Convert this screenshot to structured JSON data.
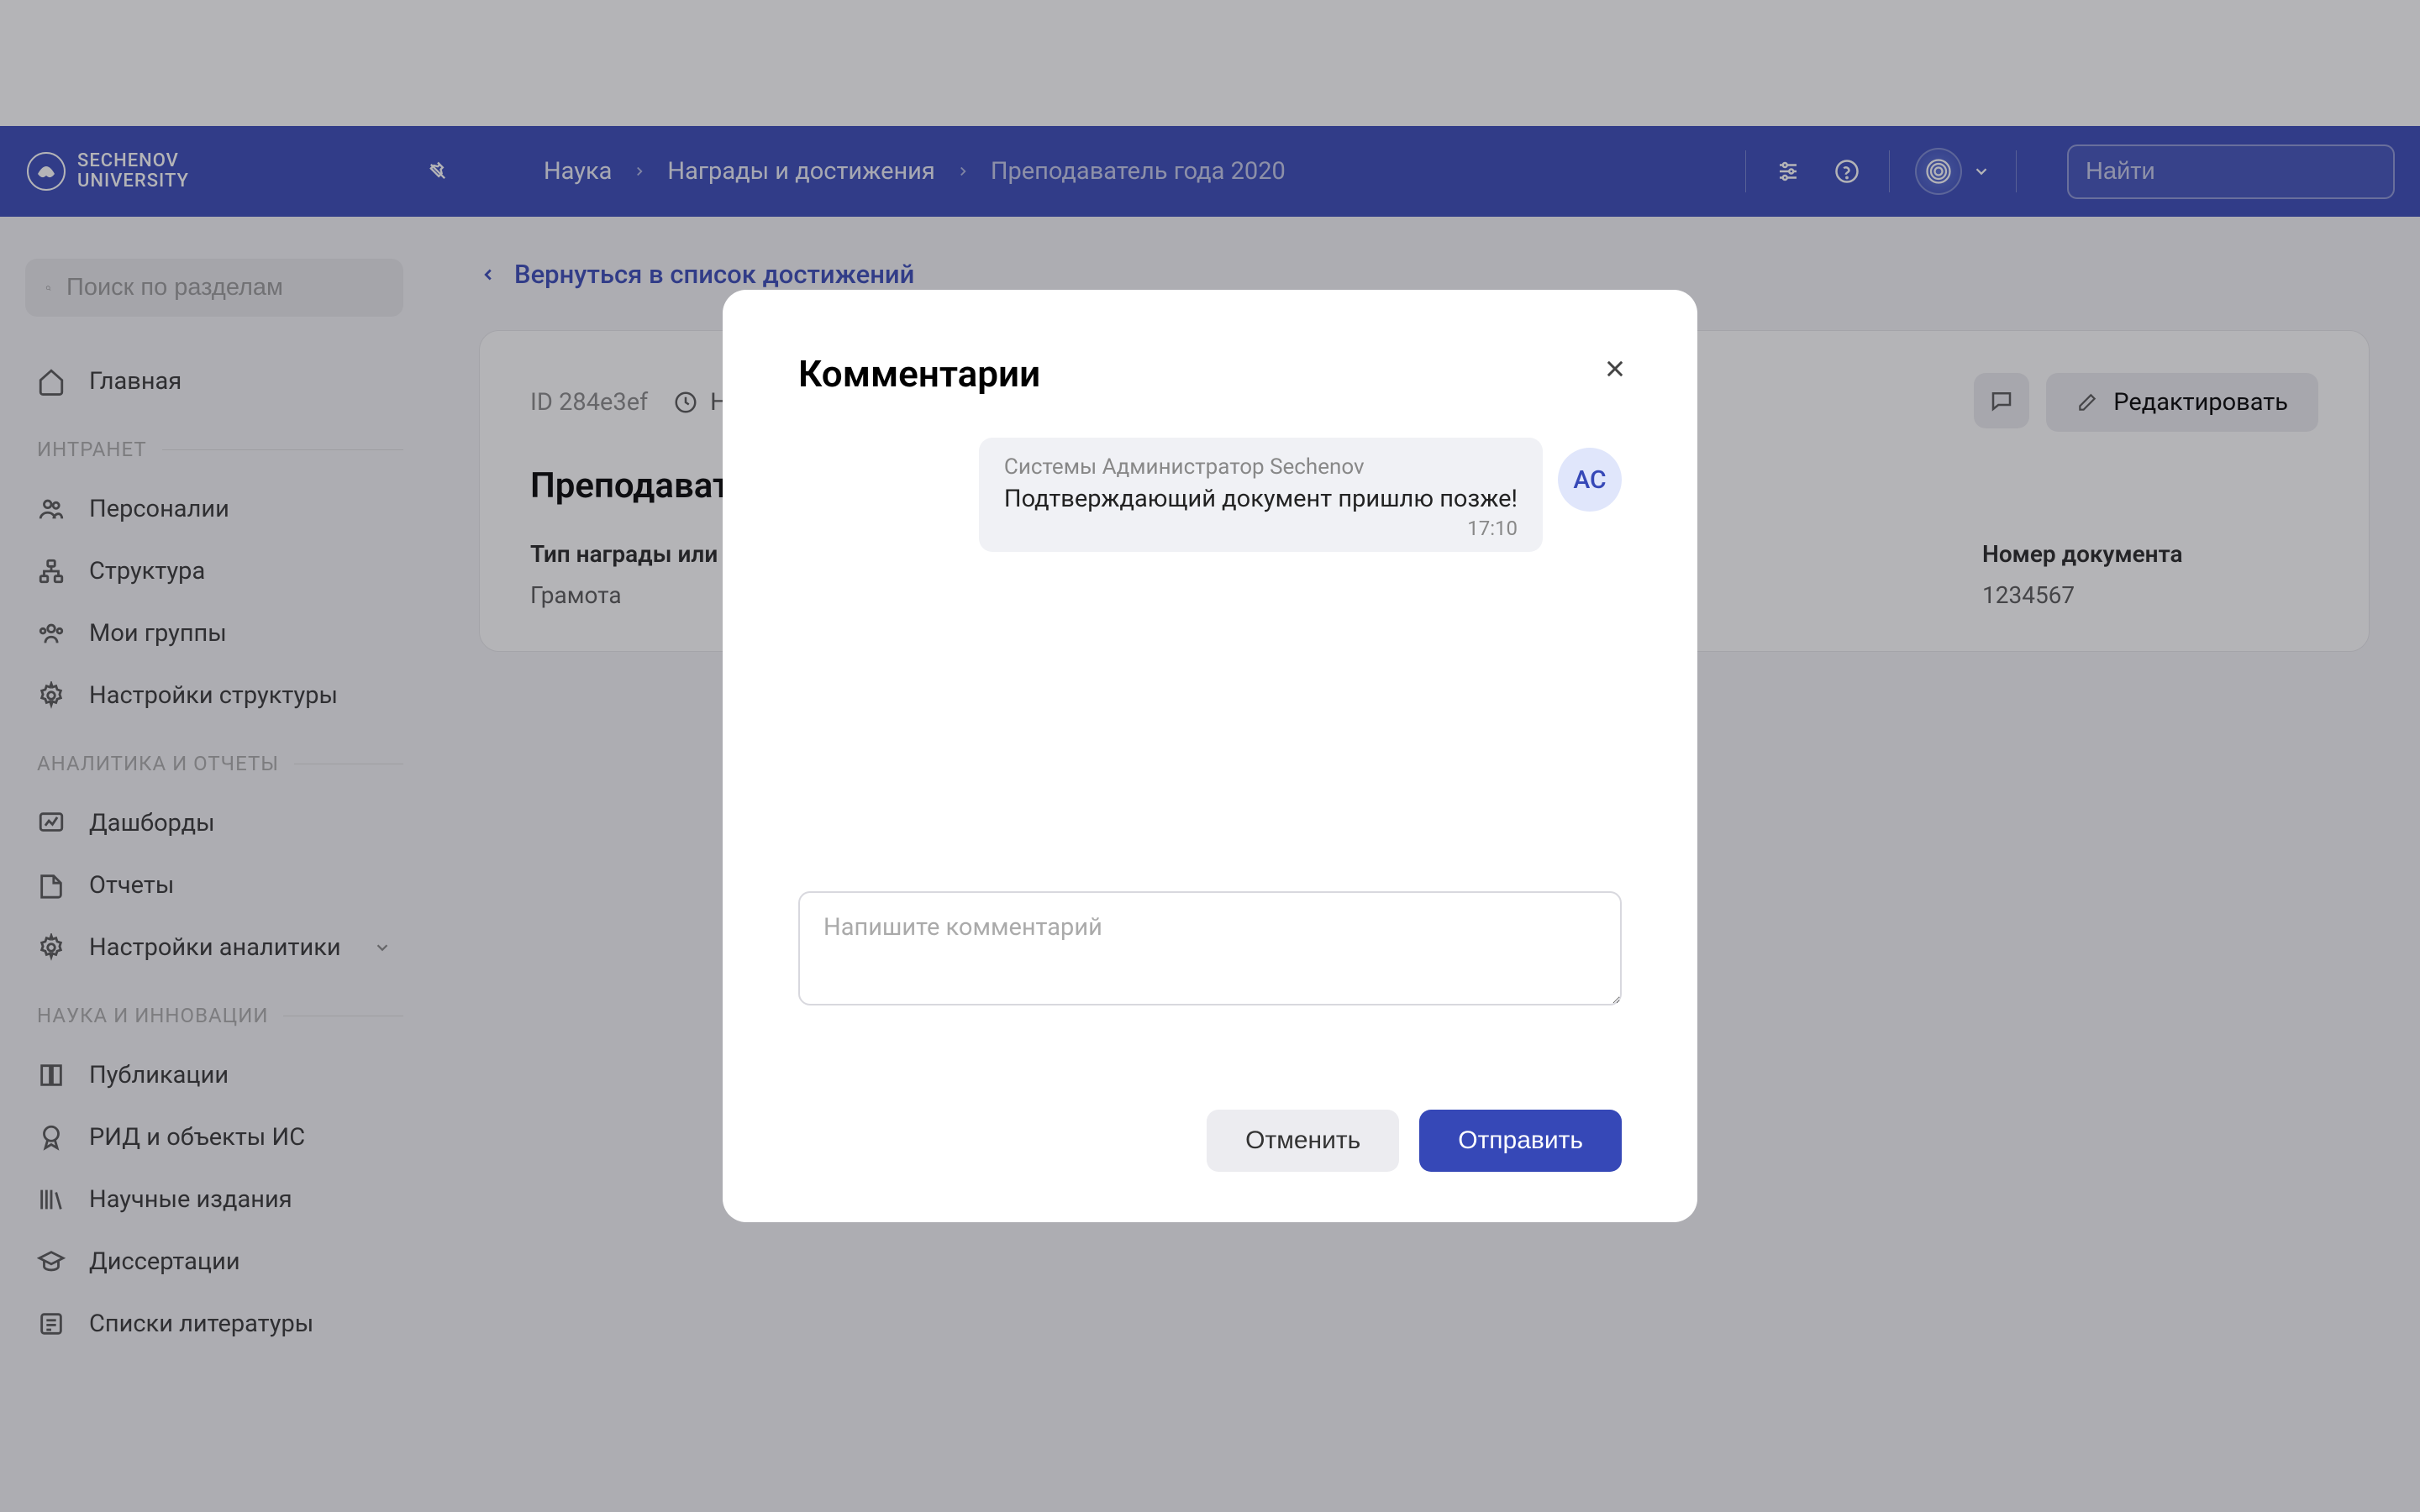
{
  "logo": {
    "line1": "SECHENOV",
    "line2": "UNIVERSITY"
  },
  "breadcrumb": {
    "item1": "Наука",
    "item2": "Награды и достижения",
    "item3": "Преподаватель года 2020"
  },
  "search_global": {
    "placeholder": "Найти"
  },
  "sidebar": {
    "search_placeholder": "Поиск по разделам",
    "home": "Главная",
    "sections": [
      {
        "label": "ИНТРАНЕТ",
        "items": [
          "Персоналии",
          "Структура",
          "Мои группы",
          "Настройки структуры"
        ]
      },
      {
        "label": "АНАЛИТИКА И ОТЧЕТЫ",
        "items": [
          "Дашборды",
          "Отчеты",
          "Настройки аналитики"
        ]
      },
      {
        "label": "НАУКА И ИННОВАЦИИ",
        "items": [
          "Публикации",
          "РИД и объекты ИС",
          "Научные издания",
          "Диссертации",
          "Списки литературы"
        ]
      }
    ]
  },
  "main": {
    "back_link": "Вернуться в список достижений",
    "card": {
      "id_prefix": "ID",
      "id_value": "284e3ef",
      "status": "Не",
      "edit_button": "Редактировать",
      "title": "Преподавател",
      "field1_label": "Тип награды или д",
      "field1_value": "Грамота",
      "field2_label": "Номер документа",
      "field2_value": "1234567"
    }
  },
  "modal": {
    "title": "Комментарии",
    "comment": {
      "author": "Системы Администратор Sechenov",
      "text": "Подтверждающий документ пришлю позже!",
      "time": "17:10",
      "avatar_initials": "АС"
    },
    "input_placeholder": "Напишите комментарий",
    "cancel": "Отменить",
    "send": "Отправить"
  }
}
